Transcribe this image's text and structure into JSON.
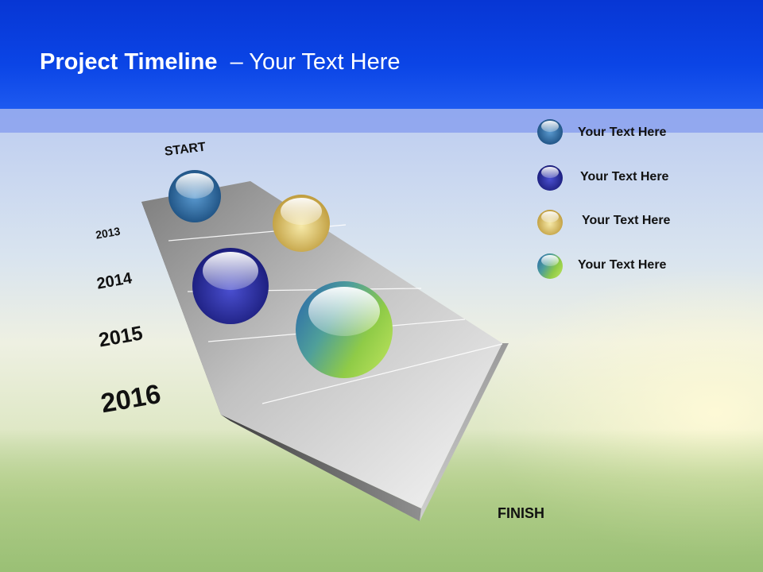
{
  "slide": {
    "title_main": "Project Timeline",
    "title_sub": "– Your Text Here"
  },
  "timeline": {
    "start_label": "START",
    "finish_label": "FINISH",
    "years": [
      "2013",
      "2014",
      "2015",
      "2016"
    ]
  },
  "legend": [
    {
      "label": "Your  Text Here",
      "color": "#2d6fa8"
    },
    {
      "label": "Your  Text Here",
      "color": "#2b2f9e"
    },
    {
      "label": "Your  Text Here",
      "color": "#d8c46a"
    },
    {
      "label": "Your  Text Here",
      "color": "#7fc04a"
    }
  ],
  "colors": {
    "header": "#0b45e6",
    "header_band": "#8aa1ee",
    "platform": "#b0b0b0"
  }
}
